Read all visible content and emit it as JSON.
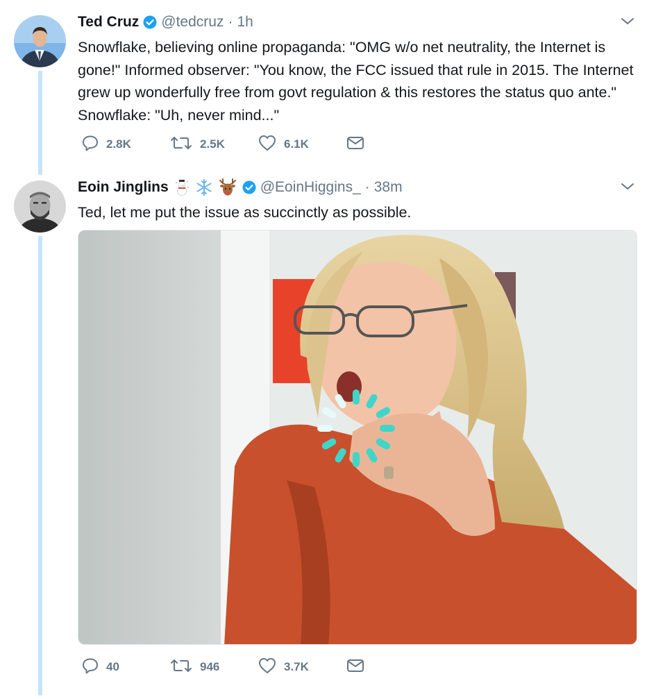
{
  "tweets": [
    {
      "author": "Ted Cruz",
      "handle": "@tedcruz",
      "separator": "·",
      "time": "1h",
      "text": "Snowflake, believing online propaganda: \"OMG w/o net neutrality, the Internet is gone!\" Informed observer: \"You know, the FCC issued that rule in 2015. The Internet grew up wonderfully free from govt regulation & this restores the status quo ante.\"  Snowflake: \"Uh, never mind...\"",
      "replies": "2.8K",
      "retweets": "2.5K",
      "likes": "6.1K",
      "icons": [
        "verified-badge-icon",
        "chevron-down-icon",
        "reply-icon",
        "retweet-icon",
        "like-icon",
        "message-icon"
      ]
    },
    {
      "author": "Eoin Jinglins",
      "emojis": [
        "snowman-emoji",
        "snowflake-emoji",
        "deer-emoji"
      ],
      "handle": "@EoinHiggins_",
      "separator": "·",
      "time": "38m",
      "text": "Ted, let me put the issue as succinctly as possible.",
      "has_media": true,
      "media_state": "loading-spinner",
      "replies": "40",
      "retweets": "946",
      "likes": "3.7K",
      "icons": [
        "verified-badge-icon",
        "chevron-down-icon",
        "reply-icon",
        "retweet-icon",
        "like-icon",
        "message-icon"
      ]
    }
  ],
  "colors": {
    "thread_line": "#c4e4fc",
    "verified": "#1da1f2",
    "secondary_text": "#657786",
    "spinner": "#3fd6c9"
  }
}
